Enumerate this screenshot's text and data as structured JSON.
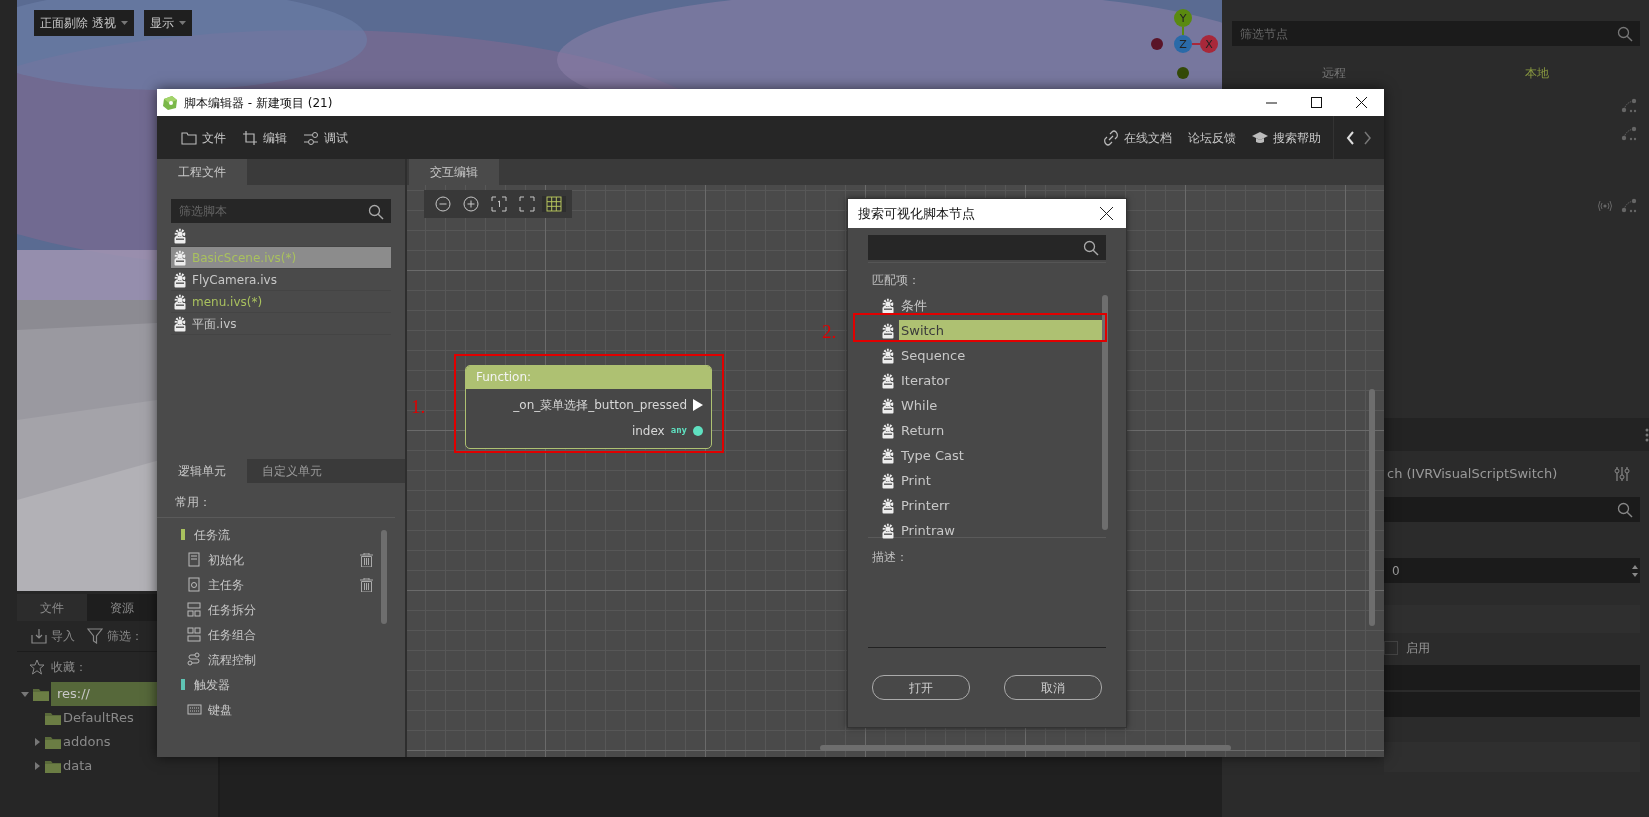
{
  "viewport": {
    "menus": [
      {
        "label": "正面剔除 透视"
      },
      {
        "label": "显示"
      }
    ],
    "gizmo_axes": [
      {
        "label": "Y",
        "color": "#5a8a10"
      },
      {
        "label": "Z",
        "color": "#2a6aa8"
      },
      {
        "label": "X",
        "color": "#a8283a"
      }
    ]
  },
  "file_dock": {
    "tabs": [
      {
        "label": "文件",
        "selected": true
      },
      {
        "label": "资源",
        "selected": false
      }
    ],
    "tools": [
      {
        "label": "导入",
        "kind": "import"
      },
      {
        "label": "筛选：",
        "kind": "filter"
      }
    ],
    "favorites": "收藏：",
    "tree": [
      {
        "label": "res://",
        "selected": true,
        "expanded": true,
        "children": [
          {
            "label": "DefaultRes",
            "selected": false
          },
          {
            "label": "addons",
            "selected": false,
            "expanded": false
          },
          {
            "label": "data",
            "selected": false,
            "expanded": false
          }
        ]
      }
    ]
  },
  "inspector": {
    "filter_placeholder": "筛选节点",
    "tabs": [
      {
        "label": "远程",
        "selected": false
      },
      {
        "label": "本地",
        "selected": true
      }
    ],
    "node_type": "ch (IVRVisualScriptSwitch)",
    "value": "0",
    "checkbox": {
      "label": "启用",
      "checked": false
    }
  },
  "script_editor": {
    "title": "脚本编辑器 - 新建项目 (21)",
    "menu": [
      {
        "label": "文件",
        "kind": "folder"
      },
      {
        "label": "编辑",
        "kind": "crop"
      },
      {
        "label": "调试",
        "kind": "debug"
      }
    ],
    "links": [
      {
        "label": "在线文档",
        "kind": "link"
      },
      {
        "label": "论坛反馈",
        "kind": "plain"
      },
      {
        "label": "搜索帮助",
        "kind": "cap"
      }
    ],
    "files_panel": {
      "tab": "工程文件",
      "filter_placeholder": "筛选脚本",
      "files": [
        {
          "selected": false
        },
        {
          "name": "BasicScene.ivs(*)",
          "selected": true,
          "modified": true
        },
        {
          "name": "FlyCamera.ivs",
          "selected": false,
          "modified": false
        },
        {
          "name": "menu.ivs(*)",
          "selected": false,
          "modified": true
        },
        {
          "name": "平面.ivs",
          "selected": false,
          "modified": false
        }
      ]
    },
    "units_panel": {
      "tabs": [
        {
          "label": "逻辑单元",
          "selected": true
        },
        {
          "label": "自定义单元",
          "selected": false
        }
      ],
      "heading": "常用：",
      "groups": [
        {
          "label": "任务流",
          "color": "#a9c15e",
          "children": [
            {
              "label": "初始化",
              "deletable": true
            },
            {
              "label": "主任务",
              "deletable": true
            },
            {
              "label": "任务拆分",
              "deletable": false
            },
            {
              "label": "任务组合",
              "deletable": false
            },
            {
              "label": "流程控制",
              "deletable": false
            }
          ]
        },
        {
          "label": "触发器",
          "color": "#5fc4b4",
          "children": [
            {
              "label": "键盘",
              "deletable": false
            }
          ]
        }
      ]
    },
    "canvas": {
      "tab": "交互编辑",
      "grid_on": true,
      "node": {
        "header": "Function:",
        "ports": [
          {
            "label": "_on_菜单选择_button_pressed",
            "kind": "exec"
          },
          {
            "label": "index",
            "kind": "value",
            "type": "any"
          }
        ]
      },
      "callouts": [
        "1.",
        "2."
      ]
    }
  },
  "search_dialog": {
    "title": "搜索可视化脚本节点",
    "matches_label": "匹配项：",
    "items": [
      {
        "label": "条件",
        "selected": false
      },
      {
        "label": "Switch",
        "selected": true
      },
      {
        "label": "Sequence",
        "selected": false
      },
      {
        "label": "Iterator",
        "selected": false
      },
      {
        "label": "While",
        "selected": false
      },
      {
        "label": "Return",
        "selected": false
      },
      {
        "label": "Type Cast",
        "selected": false
      },
      {
        "label": "Print",
        "selected": false
      },
      {
        "label": "Printerr",
        "selected": false
      },
      {
        "label": "Printraw",
        "selected": false
      }
    ],
    "description_label": "描述：",
    "buttons": [
      "打开",
      "取消"
    ]
  }
}
